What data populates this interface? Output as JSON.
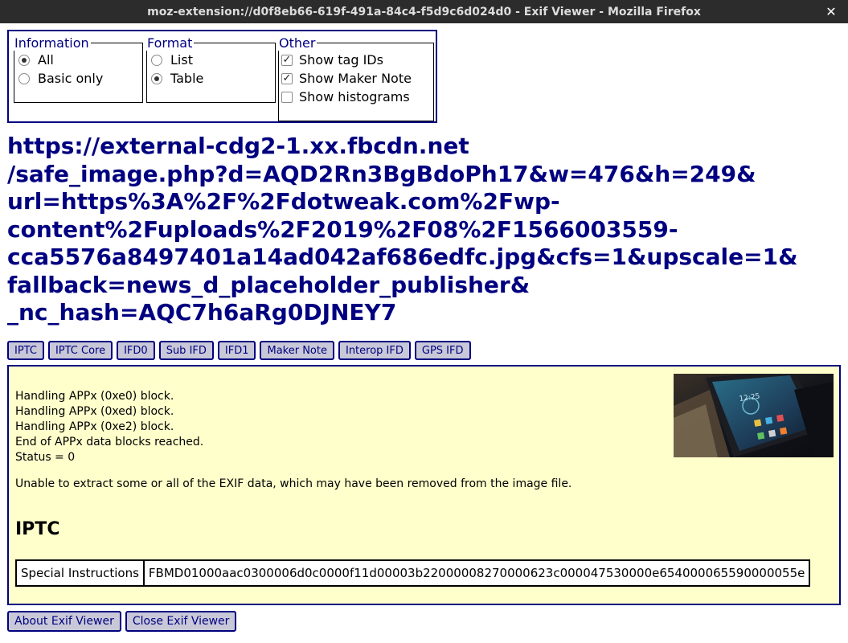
{
  "window": {
    "title": "moz-extension://d0f8eb66-619f-491a-84c4-f5d9c6d024d0 - Exif Viewer - Mozilla Firefox",
    "close_glyph": "✕"
  },
  "options": {
    "information": {
      "legend": "Information",
      "items": [
        {
          "label": "All",
          "selected": true
        },
        {
          "label": "Basic only",
          "selected": false
        }
      ]
    },
    "format": {
      "legend": "Format",
      "items": [
        {
          "label": "List",
          "selected": false
        },
        {
          "label": "Table",
          "selected": true
        }
      ]
    },
    "other": {
      "legend": "Other",
      "items": [
        {
          "label": "Show tag IDs",
          "checked": true
        },
        {
          "label": "Show Maker Note",
          "checked": true
        },
        {
          "label": "Show histograms",
          "checked": false
        }
      ]
    }
  },
  "url_title": "https://external-cdg2-1.xx.fbcdn.net\n/safe_image.php?d=AQD2Rn3BgBdoPh17&w=476&h=249&\nurl=https%3A%2F%2Fdotweak.com%2Fwp-\ncontent%2Fuploads%2F2019%2F08%2F1566003559-\ncca5576a8497401a14ad042af686edfc.jpg&cfs=1&upscale=1&\nfallback=news_d_placeholder_publisher&\n_nc_hash=AQC7h6aRg0DJNEY7",
  "tabs": [
    "IPTC",
    "IPTC Core",
    "IFD0",
    "Sub IFD",
    "IFD1",
    "Maker Note",
    "Interop IFD",
    "GPS IFD"
  ],
  "log_lines": [
    "Handling APPx (0xe0) block.",
    "Handling APPx (0xed) block.",
    "Handling APPx (0xe2) block.",
    "End of APPx data blocks reached.",
    "Status = 0"
  ],
  "message": "Unable to extract some or all of the EXIF data, which may have been removed from the image file.",
  "section_title": "IPTC",
  "iptc_rows": [
    {
      "key": "Special Instructions",
      "value": "FBMD01000aac0300006d0c0000f11d00003b22000008270000623c000047530000e654000065590000055e"
    }
  ],
  "thumbnail": {
    "clock": "12:25"
  },
  "bottom_buttons": {
    "about": "About Exif Viewer",
    "close": "Close Exif Viewer"
  }
}
